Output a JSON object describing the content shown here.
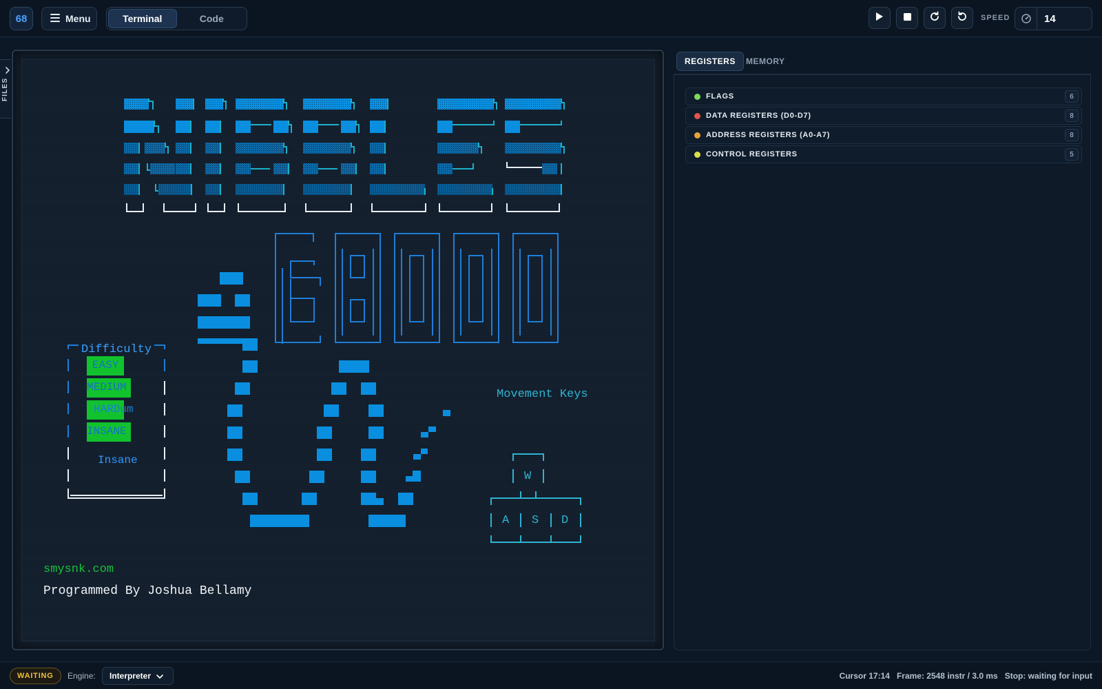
{
  "app": {
    "logo_text": "68"
  },
  "toolbar": {
    "menu_label": "Menu",
    "tabs": [
      {
        "label": "Terminal",
        "active": true
      },
      {
        "label": "Code",
        "active": false
      }
    ],
    "speed_label": "SPEED",
    "speed_value": "14"
  },
  "files_tab": {
    "label": "FILES"
  },
  "terminal": {
    "difficulty_title": "Difficulty",
    "difficulty_options": [
      "EASY",
      "MEDIUM",
      "HARDum",
      "INSANE"
    ],
    "difficulty_current": "Insane",
    "movement_title": "Movement Keys",
    "keys": [
      "W",
      "A",
      "S",
      "D"
    ],
    "site": "smysnk.com",
    "credit": "Programmed By Joshua Bellamy",
    "colors": {
      "logo_blue": "#0a8fe0",
      "outline_blue": "#1e7ed8",
      "highlight_green": "#11c22e",
      "text_green": "#18c23a",
      "key_cyan": "#2fb3d0"
    }
  },
  "right_panel": {
    "tabs": [
      {
        "label": "REGISTERS",
        "active": true
      },
      {
        "label": "MEMORY",
        "active": false
      }
    ],
    "sections": [
      {
        "label": "FLAGS",
        "count": "6",
        "color": "#7ed957"
      },
      {
        "label": "DATA REGISTERS (D0-D7)",
        "count": "8",
        "color": "#e5534b"
      },
      {
        "label": "ADDRESS REGISTERS (A0-A7)",
        "count": "8",
        "color": "#e8a13a"
      },
      {
        "label": "CONTROL REGISTERS",
        "count": "5",
        "color": "#d9e04a"
      }
    ]
  },
  "statusbar": {
    "status": "WAITING",
    "engine_label": "Engine:",
    "engine_value": "Interpreter",
    "cursor": "Cursor 17:14",
    "frame": "Frame: 2548 instr / 3.0 ms",
    "stop": "Stop: waiting for input"
  }
}
